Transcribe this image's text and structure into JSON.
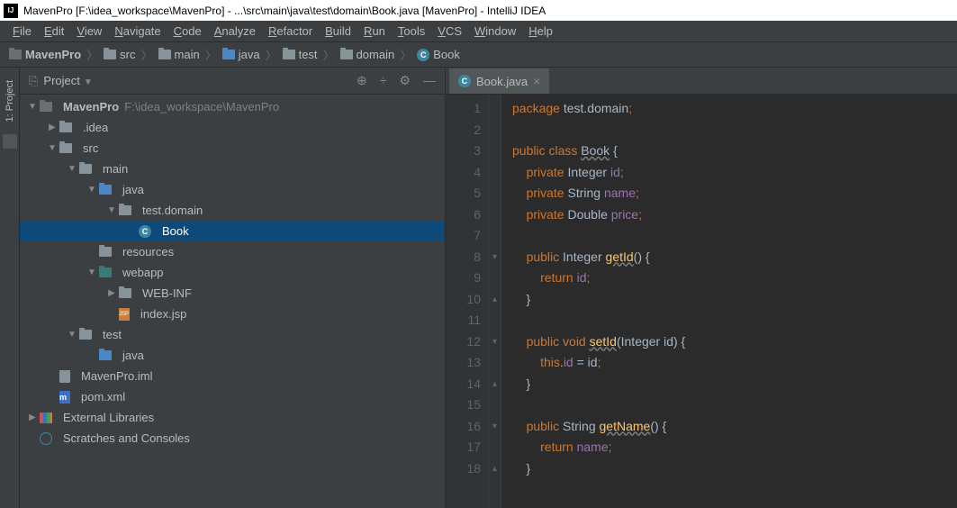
{
  "window_title": "MavenPro [F:\\idea_workspace\\MavenPro] - ...\\src\\main\\java\\test\\domain\\Book.java [MavenPro] - IntelliJ IDEA",
  "menu": [
    "File",
    "Edit",
    "View",
    "Navigate",
    "Code",
    "Analyze",
    "Refactor",
    "Build",
    "Run",
    "Tools",
    "VCS",
    "Window",
    "Help"
  ],
  "breadcrumb": [
    {
      "label": "MavenPro",
      "icon": "folder-gray",
      "bold": true
    },
    {
      "label": "src",
      "icon": "folder"
    },
    {
      "label": "main",
      "icon": "folder"
    },
    {
      "label": "java",
      "icon": "folder-blue"
    },
    {
      "label": "test",
      "icon": "folder"
    },
    {
      "label": "domain",
      "icon": "folder"
    },
    {
      "label": "Book",
      "icon": "class"
    }
  ],
  "sidebar_tab": "1: Project",
  "project_panel": {
    "title": "Project"
  },
  "tree": [
    {
      "depth": 0,
      "expander": "▼",
      "icon": "folder-gray",
      "label": "MavenPro",
      "hint": "F:\\idea_workspace\\MavenPro",
      "bold": true
    },
    {
      "depth": 1,
      "expander": "▶",
      "icon": "folder",
      "label": ".idea"
    },
    {
      "depth": 1,
      "expander": "▼",
      "icon": "folder",
      "label": "src"
    },
    {
      "depth": 2,
      "expander": "▼",
      "icon": "folder",
      "label": "main"
    },
    {
      "depth": 3,
      "expander": "▼",
      "icon": "folder-blue",
      "label": "java"
    },
    {
      "depth": 4,
      "expander": "▼",
      "icon": "folder",
      "label": "test.domain"
    },
    {
      "depth": 5,
      "expander": "",
      "icon": "class",
      "label": "Book",
      "selected": true
    },
    {
      "depth": 3,
      "expander": "",
      "icon": "folder",
      "label": "resources"
    },
    {
      "depth": 3,
      "expander": "▼",
      "icon": "folder-teal",
      "label": "webapp"
    },
    {
      "depth": 4,
      "expander": "▶",
      "icon": "folder",
      "label": "WEB-INF"
    },
    {
      "depth": 4,
      "expander": "",
      "icon": "file-jsp",
      "label": "index.jsp"
    },
    {
      "depth": 2,
      "expander": "▼",
      "icon": "folder",
      "label": "test"
    },
    {
      "depth": 3,
      "expander": "",
      "icon": "folder-blue",
      "label": "java"
    },
    {
      "depth": 1,
      "expander": "",
      "icon": "file",
      "label": "MavenPro.iml"
    },
    {
      "depth": 1,
      "expander": "",
      "icon": "file-m",
      "label": "pom.xml"
    },
    {
      "depth": 0,
      "expander": "▶",
      "icon": "lib",
      "label": "External Libraries"
    },
    {
      "depth": 0,
      "expander": "",
      "icon": "scratch",
      "label": "Scratches and Consoles"
    }
  ],
  "editor_tab": "Book.java",
  "code_lines": [
    {
      "n": 1,
      "html": "<span class='kw'>package</span> <span class='pkg'>test.domain</span><span class='semi'>;</span>"
    },
    {
      "n": 2,
      "html": ""
    },
    {
      "n": 3,
      "html": "<span class='kw'>public class</span> <span class='cls'>Book</span> {"
    },
    {
      "n": 4,
      "html": "    <span class='kw'>private</span> Integer <span class='ident'>id</span><span class='semi'>;</span>"
    },
    {
      "n": 5,
      "html": "    <span class='kw'>private</span> String <span class='ident'>name</span><span class='semi'>;</span>"
    },
    {
      "n": 6,
      "html": "    <span class='kw'>private</span> Double <span class='ident'>price</span><span class='semi'>;</span>"
    },
    {
      "n": 7,
      "html": ""
    },
    {
      "n": 8,
      "html": "    <span class='kw'>public</span> Integer <span class='method'>getId</span>() {",
      "mark": "▾"
    },
    {
      "n": 9,
      "html": "        <span class='kw'>return</span> <span class='ident'>id</span><span class='semi'>;</span>"
    },
    {
      "n": 10,
      "html": "    }",
      "mark": "▴"
    },
    {
      "n": 11,
      "html": ""
    },
    {
      "n": 12,
      "html": "    <span class='kw'>public void</span> <span class='method'>setId</span>(Integer id) {",
      "mark": "▾"
    },
    {
      "n": 13,
      "html": "        <span class='kw'>this</span>.<span class='ident'>id</span> = id<span class='semi'>;</span>"
    },
    {
      "n": 14,
      "html": "    }",
      "mark": "▴"
    },
    {
      "n": 15,
      "html": ""
    },
    {
      "n": 16,
      "html": "    <span class='kw'>public</span> String <span class='method'>getName</span>() {",
      "mark": "▾"
    },
    {
      "n": 17,
      "html": "        <span class='kw'>return</span> <span class='ident'>name</span><span class='semi'>;</span>"
    },
    {
      "n": 18,
      "html": "    }",
      "mark": "▴"
    }
  ]
}
